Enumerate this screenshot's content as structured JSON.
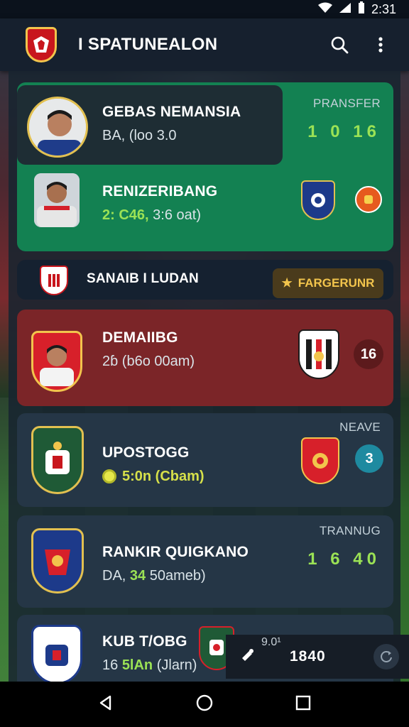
{
  "status_bar": {
    "time": "2:31",
    "wifi_icon": "wifi-icon",
    "signal_icon": "signal-icon",
    "battery_icon": "battery-icon"
  },
  "app_bar": {
    "title": "I SPATUNEALON",
    "logo_icon": "club-crest-icon",
    "search_icon": "search-icon",
    "menu_icon": "more-vert-icon"
  },
  "cards": [
    {
      "hint": "PRANSFER",
      "name": "GEBAS NEMANSIA",
      "sub": "BA, (loo 3.0",
      "score": "1 0  16"
    },
    {
      "name": "RENIZERIBANG",
      "sub_accent": "2: C46,",
      "sub": " 3:6 oat)"
    },
    {
      "name": "SANAIB I LUDAN",
      "fav_label": "FARGERUNR",
      "fav_icon": "star-icon"
    },
    {
      "name": "DEMAIIBG",
      "sub": "2ɓ (b6o 00am)",
      "badge": "16"
    },
    {
      "hint": "NEAVE",
      "name": "UPOSTOGG",
      "sub": "5:0n (Cbam)",
      "badge": "3"
    },
    {
      "hint": "TRANNUG",
      "name": "RANKIR QUIGKANO",
      "sub_prefix": "DA, ",
      "sub_accent": "34",
      "sub": "  50ameb)",
      "score": "1 6  40"
    },
    {
      "name": "KUB T/OBG",
      "sub_prefix": "16 ",
      "sub_accent": "5lAn",
      "sub": " (Jlarn)"
    }
  ],
  "floating_bar": {
    "small": "9.0¹",
    "main": "1840",
    "icon": "whistle-icon",
    "refresh_icon": "refresh-icon"
  },
  "colors": {
    "primary_green": "#138152",
    "accent_lime": "#9be255",
    "danger_red": "#7b2528",
    "gold": "#f2c44c"
  },
  "nav": {
    "back_icon": "back-icon",
    "home_icon": "home-icon",
    "recents_icon": "recents-icon"
  }
}
